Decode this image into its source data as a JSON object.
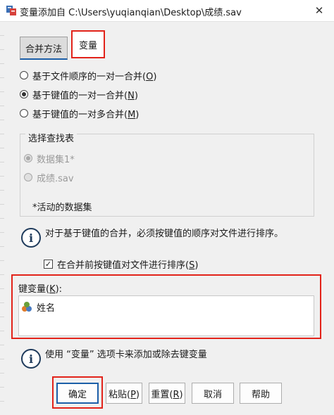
{
  "window": {
    "title": "变量添加自 C:\\Users\\yuqianqian\\Desktop\\成绩.sav",
    "close_glyph": "✕"
  },
  "tabs": [
    {
      "label": "合并方法",
      "selected": true
    },
    {
      "label": "变量",
      "selected": false
    }
  ],
  "merge_methods": [
    {
      "prefix": "基于文件顺序的一对一合并(",
      "key": "O",
      "suffix": ")",
      "checked": false
    },
    {
      "prefix": "基于键值的一对一合并(",
      "key": "N",
      "suffix": ")",
      "checked": true
    },
    {
      "prefix": "基于键值的一对多合并(",
      "key": "M",
      "suffix": ")",
      "checked": false
    }
  ],
  "lookup_table": {
    "title": "选择查找表",
    "options": [
      {
        "label": "数据集1*",
        "checked": true,
        "disabled": true
      },
      {
        "label": "成绩.sav",
        "checked": false,
        "disabled": true
      }
    ],
    "note": "*活动的数据集"
  },
  "info_sort": "对于基于键值的合并，必须按键值的顺序对文件进行排序。",
  "sort_checkbox": {
    "prefix": "在合并前按键值对文件进行排序(",
    "key": "S",
    "suffix": ")",
    "checked": true,
    "check_glyph": "✓"
  },
  "key_variables": {
    "label_prefix": "键变量(",
    "label_key": "K",
    "label_suffix": "):",
    "items": [
      "姓名"
    ]
  },
  "info_vars": "使用 “变量” 选项卡来添加或除去键变量",
  "buttons": {
    "ok": "确定",
    "paste_prefix": "粘贴(",
    "paste_key": "P",
    "paste_suffix": ")",
    "reset_prefix": "重置(",
    "reset_key": "R",
    "reset_suffix": ")",
    "cancel": "取消",
    "help": "帮助"
  },
  "colors": {
    "highlight": "#e2231a",
    "accent": "#1c5fa8"
  },
  "icons": {
    "app": "spss-merge-icon",
    "info": "info-icon",
    "variable": "nominal-variable-icon"
  }
}
